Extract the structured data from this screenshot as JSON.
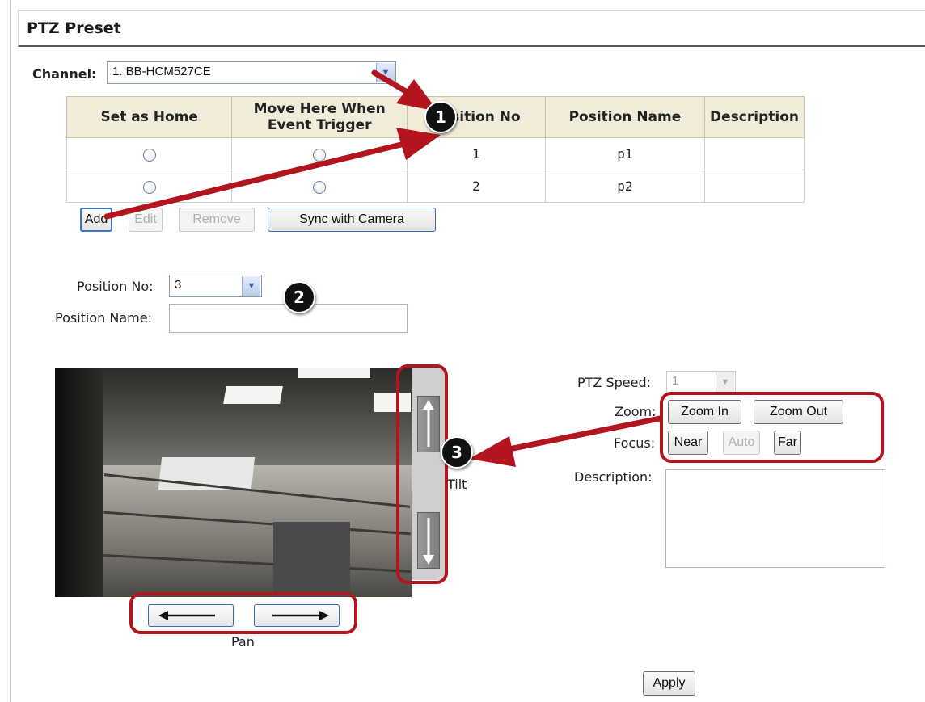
{
  "page": {
    "title": "PTZ Preset"
  },
  "channel": {
    "label": "Channel:",
    "value": "1. BB-HCM527CE"
  },
  "preset_table": {
    "headers": [
      "Set as Home",
      "Move Here When Event Trigger",
      "Position No",
      "Position Name",
      "Description"
    ],
    "rows": [
      {
        "position_no": "1",
        "position_name": "p1",
        "description": ""
      },
      {
        "position_no": "2",
        "position_name": "p2",
        "description": ""
      }
    ]
  },
  "table_buttons": {
    "add": "Add",
    "edit": "Edit",
    "remove": "Remove",
    "sync": "Sync with Camera"
  },
  "position_form": {
    "position_no_label": "Position No:",
    "position_no_value": "3",
    "position_name_label": "Position Name:",
    "position_name_value": ""
  },
  "ptz_controls": {
    "tilt_caption": "Tilt",
    "pan_caption": "Pan",
    "tilt_up_icon": "arrow-up-icon",
    "tilt_down_icon": "arrow-down-icon",
    "pan_left_icon": "arrow-left-icon",
    "pan_right_icon": "arrow-right-icon"
  },
  "ptz_settings": {
    "speed_label": "PTZ Speed:",
    "speed_value": "1",
    "zoom_label": "Zoom:",
    "zoom_in": "Zoom In",
    "zoom_out": "Zoom Out",
    "focus_label": "Focus:",
    "near": "Near",
    "auto": "Auto",
    "far": "Far",
    "description_label": "Description:",
    "description_value": ""
  },
  "apply_button": "Apply",
  "annotations": {
    "badge_1": "1",
    "badge_2": "2",
    "badge_3": "3",
    "color": "#b3151e"
  }
}
